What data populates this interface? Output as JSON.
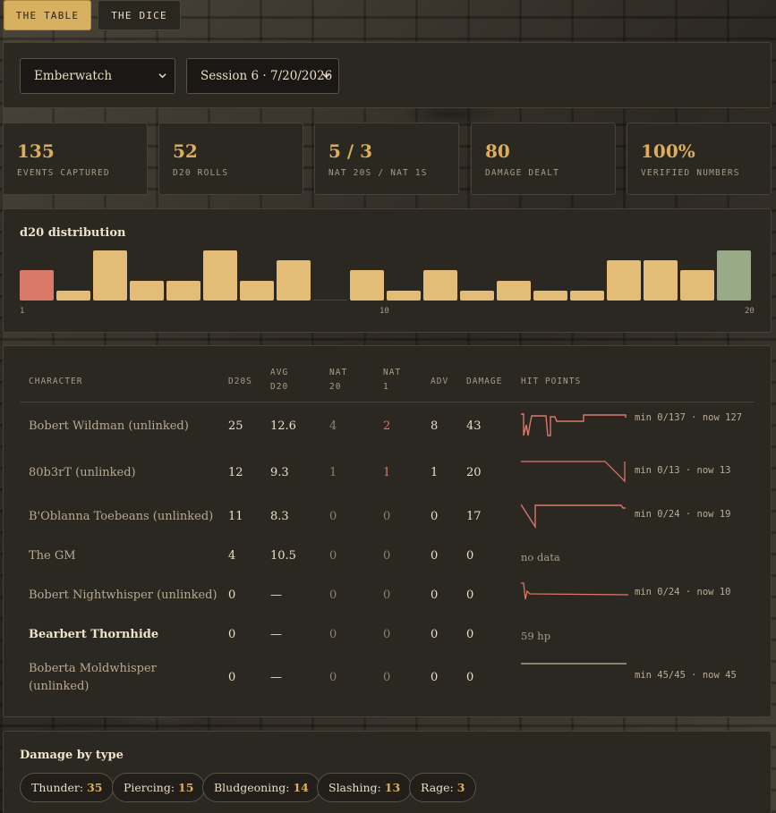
{
  "tabs": [
    {
      "label": "THE TABLE",
      "active": true
    },
    {
      "label": "THE DICE",
      "active": false
    }
  ],
  "filters": {
    "campaign": "Emberwatch",
    "session": "Session 6 · 7/20/2026"
  },
  "stats": [
    {
      "value": "135",
      "label": "EVENTS CAPTURED"
    },
    {
      "value": "52",
      "label": "D20 ROLLS"
    },
    {
      "value": "5 / 3",
      "label": "NAT 20S / NAT 1S"
    },
    {
      "value": "80",
      "label": "DAMAGE DEALT"
    },
    {
      "value": "100%",
      "label": "VERIFIED NUMBERS"
    }
  ],
  "distribution": {
    "title": "d20 distribution",
    "axis_labels": [
      "1",
      "10",
      "20"
    ]
  },
  "chart_data": {
    "type": "bar",
    "title": "d20 distribution",
    "categories": [
      1,
      2,
      3,
      4,
      5,
      6,
      7,
      8,
      9,
      10,
      11,
      12,
      13,
      14,
      15,
      16,
      17,
      18,
      19,
      20
    ],
    "values": [
      3,
      1,
      5,
      2,
      2,
      5,
      2,
      4,
      0,
      3,
      1,
      3,
      1,
      2,
      1,
      1,
      4,
      4,
      3,
      5
    ],
    "ylim": [
      0,
      5
    ],
    "colors": {
      "nat1": "#d9796a",
      "normal": "#e3bd77",
      "nat20": "#98aa86"
    }
  },
  "table": {
    "headers": {
      "character": "CHARACTER",
      "d20s": "D20S",
      "avg_d20": [
        "AVG",
        "D20"
      ],
      "nat20": [
        "NAT",
        "20"
      ],
      "nat1": [
        "NAT",
        "1"
      ],
      "adv": "ADV",
      "damage": "DAMAGE",
      "hit_points": "HIT POINTS"
    },
    "rows": [
      {
        "name": "Bobert Wildman (unlinked)",
        "d20s": "25",
        "avg": "12.6",
        "nat20": "4",
        "nat1": "2",
        "adv": "8",
        "damage": "43",
        "hp": "min 0/137 · now 127"
      },
      {
        "name": "80b3rT (unlinked)",
        "d20s": "12",
        "avg": "9.3",
        "nat20": "1",
        "nat1": "1",
        "adv": "1",
        "damage": "20",
        "hp": "min 0/13 · now 13"
      },
      {
        "name": "B'Oblanna Toebeans (unlinked)",
        "d20s": "11",
        "avg": "8.3",
        "nat20": "0",
        "nat1": "0",
        "adv": "0",
        "damage": "17",
        "hp": "min 0/24 · now 19"
      },
      {
        "name": "The GM",
        "d20s": "4",
        "avg": "10.5",
        "nat20": "0",
        "nat1": "0",
        "adv": "0",
        "damage": "0",
        "hp": "no data"
      },
      {
        "name": "Bobert Nightwhisper (unlinked)",
        "d20s": "0",
        "avg": "—",
        "nat20": "0",
        "nat1": "0",
        "adv": "0",
        "damage": "0",
        "hp": "min 0/24 · now 10"
      },
      {
        "name": "Bearbert Thornhide",
        "d20s": "0",
        "avg": "—",
        "nat20": "0",
        "nat1": "0",
        "adv": "0",
        "damage": "0",
        "hp": "59 hp"
      },
      {
        "name": "Boberta Moldwhisper (unlinked)",
        "d20s": "0",
        "avg": "—",
        "nat20": "0",
        "nat1": "0",
        "adv": "0",
        "damage": "0",
        "hp": "min 45/45 · now 45"
      }
    ]
  },
  "damage_by_type": {
    "title": "Damage by type",
    "chips": [
      {
        "label": "Thunder:",
        "value": "35"
      },
      {
        "label": "Piercing:",
        "value": "15"
      },
      {
        "label": "Bludgeoning:",
        "value": "14"
      },
      {
        "label": "Slashing:",
        "value": "13"
      },
      {
        "label": "Rage:",
        "value": "3"
      }
    ]
  },
  "colors": {
    "accent": "#dcae5a",
    "hp_low": "#d9796a",
    "hp_full": "#98aa86"
  }
}
